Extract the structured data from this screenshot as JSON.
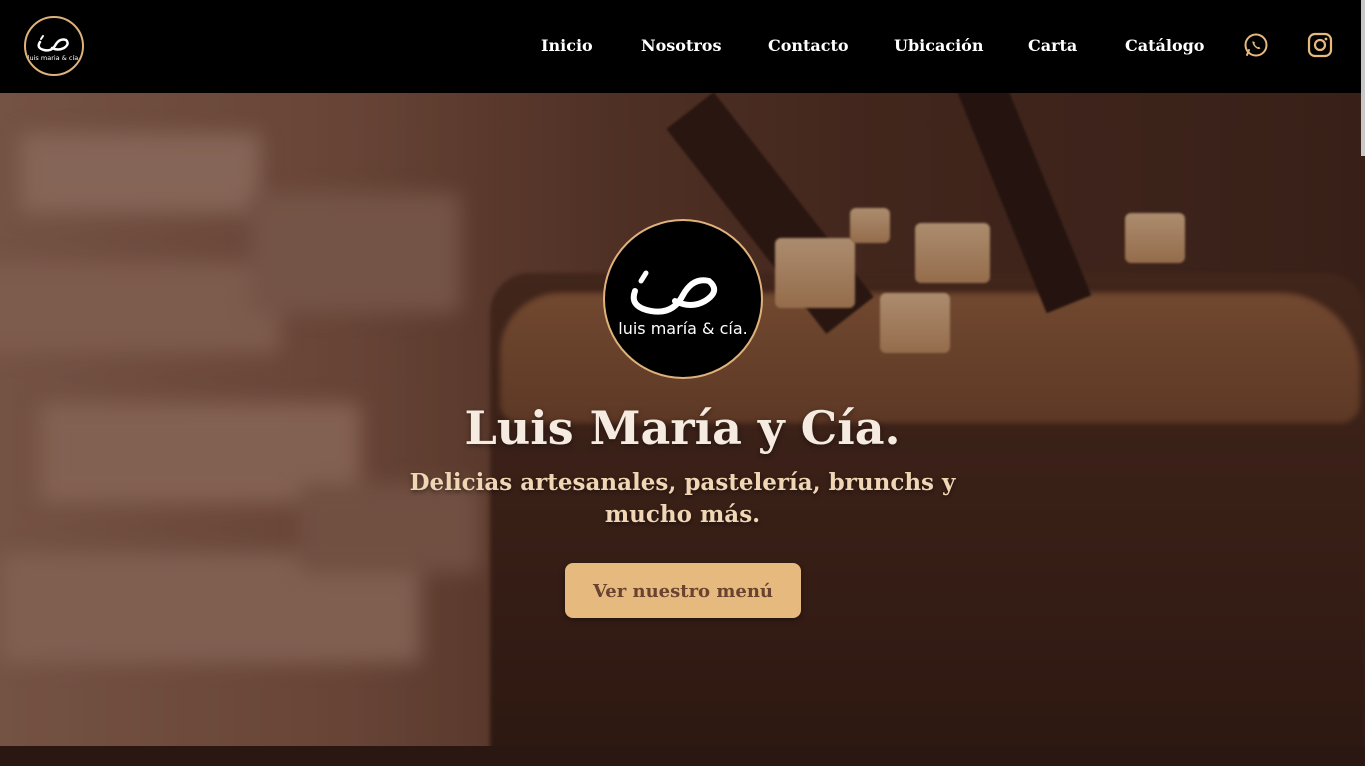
{
  "header": {
    "logo_text": "luis maria & cía.",
    "nav": [
      {
        "label": "Inicio"
      },
      {
        "label": "Nosotros"
      },
      {
        "label": "Contacto"
      },
      {
        "label": "Ubicación"
      },
      {
        "label": "Carta"
      },
      {
        "label": "Catálogo"
      }
    ],
    "social": [
      {
        "icon": "whatsapp-icon"
      },
      {
        "icon": "instagram-icon"
      }
    ]
  },
  "hero": {
    "logo_text": "luis maría & cía.",
    "title": "Luis María y Cía.",
    "subtitle": "Delicias artesanales, pastelería, brunchs y mucho más.",
    "cta_label": "Ver nuestro menú"
  },
  "colors": {
    "accent": "#e6b97f",
    "header_bg": "#000000",
    "title": "#f6ebe0",
    "subtitle": "#f1d6b6"
  }
}
